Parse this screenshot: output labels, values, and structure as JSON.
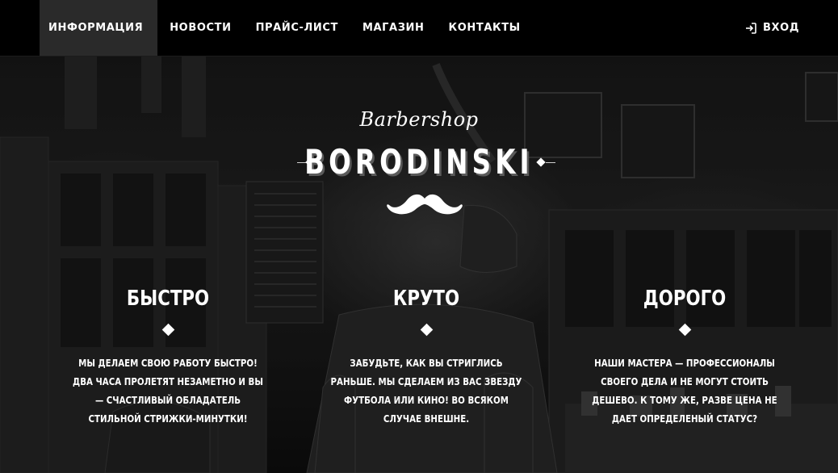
{
  "nav": {
    "items": [
      {
        "label": "ИНФОРМАЦИЯ",
        "active": true
      },
      {
        "label": "НОВОСТИ",
        "active": false
      },
      {
        "label": "ПРАЙС-ЛИСТ",
        "active": false
      },
      {
        "label": "МАГАЗИН",
        "active": false
      },
      {
        "label": "КОНТАКТЫ",
        "active": false
      }
    ],
    "login": {
      "label": "ВХОД",
      "icon": "login-icon"
    }
  },
  "brand": {
    "script": "Barbershop",
    "name": "BORODINSKI",
    "emblem": "mustache-icon"
  },
  "features": [
    {
      "title": "БЫСТРО",
      "text": "МЫ ДЕЛАЕМ СВОЮ РАБОТУ БЫСТРО! ДВА ЧАСА ПРОЛЕТЯТ НЕЗАМЕТНО И ВЫ — СЧАСТЛИВЫЙ ОБЛАДАТЕЛЬ СТИЛЬНОЙ СТРИЖКИ-МИНУТКИ!"
    },
    {
      "title": "КРУТО",
      "text": "ЗАБУДЬТЕ, КАК ВЫ СТРИГЛИСЬ РАНЬШЕ. МЫ СДЕЛАЕМ ИЗ ВАС ЗВЕЗДУ ФУТБОЛА ИЛИ КИНО! ВО ВСЯКОМ СЛУЧАЕ ВНЕШНЕ."
    },
    {
      "title": "ДОРОГО",
      "text": "НАШИ МАСТЕРА — ПРОФЕССИОНАЛЫ СВОЕГО ДЕЛА И НЕ МОГУТ СТОИТЬ ДЕШЕВО. К ТОМУ ЖЕ, РАЗВЕ ЦЕНА НЕ ДАЕТ ОПРЕДЕЛЕНЫЙ СТАТУС?"
    }
  ],
  "colors": {
    "navbar_bg": "#000000",
    "nav_active_bg": "#2a2a2a",
    "text": "#ffffff"
  }
}
